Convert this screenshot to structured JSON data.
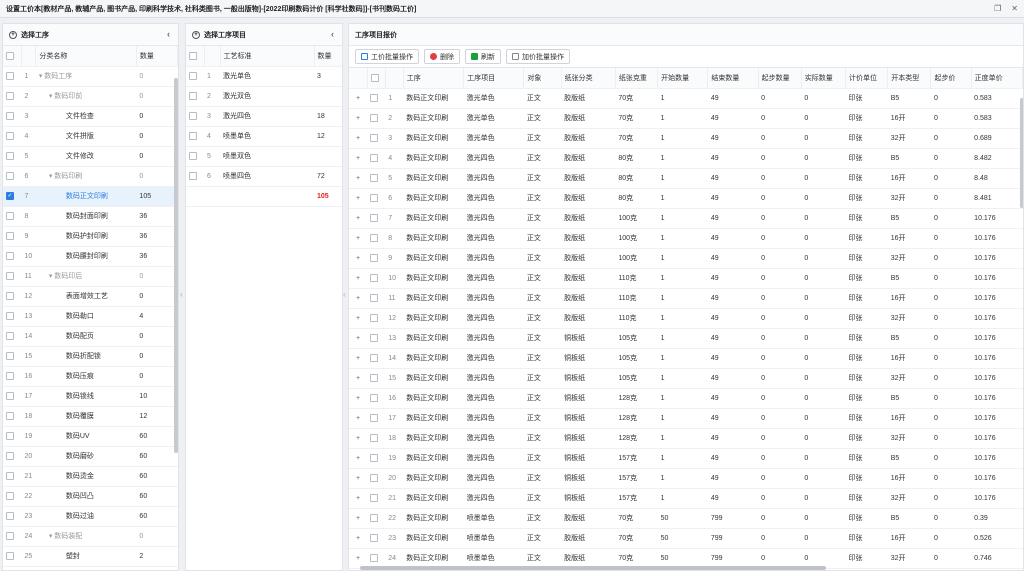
{
  "window": {
    "title": "设置工价本[教材产品, 教辅产品, 图书产品, 印刷科学技术, 社科类图书, 一般出版物]-[2022印刷数码计价 [科学社数码]]-[书刊数码工价]"
  },
  "left": {
    "header": "选择工序",
    "columns": [
      "分类名称",
      "数量"
    ],
    "rows": [
      {
        "n": "1",
        "name": "数码工序",
        "qty": "0",
        "group": true,
        "indent": 0
      },
      {
        "n": "2",
        "name": "数码印前",
        "qty": "0",
        "group": true,
        "indent": 1
      },
      {
        "n": "3",
        "name": "文件检查",
        "qty": "0",
        "group": false,
        "indent": 2
      },
      {
        "n": "4",
        "name": "文件拼版",
        "qty": "0",
        "group": false,
        "indent": 2
      },
      {
        "n": "5",
        "name": "文件修改",
        "qty": "0",
        "group": false,
        "indent": 2
      },
      {
        "n": "6",
        "name": "数码印刷",
        "qty": "0",
        "group": true,
        "indent": 1
      },
      {
        "n": "7",
        "name": "数码正文印刷",
        "qty": "105",
        "group": false,
        "indent": 2,
        "selected": true
      },
      {
        "n": "8",
        "name": "数码封面印刷",
        "qty": "36",
        "group": false,
        "indent": 2
      },
      {
        "n": "9",
        "name": "数码护封印刷",
        "qty": "36",
        "group": false,
        "indent": 2
      },
      {
        "n": "10",
        "name": "数码腰封印刷",
        "qty": "36",
        "group": false,
        "indent": 2
      },
      {
        "n": "11",
        "name": "数码印后",
        "qty": "0",
        "group": true,
        "indent": 1
      },
      {
        "n": "12",
        "name": "表面增效工艺",
        "qty": "0",
        "group": false,
        "indent": 2
      },
      {
        "n": "13",
        "name": "数码勒口",
        "qty": "4",
        "group": false,
        "indent": 2
      },
      {
        "n": "14",
        "name": "数码配页",
        "qty": "0",
        "group": false,
        "indent": 2
      },
      {
        "n": "15",
        "name": "数码折配锁",
        "qty": "0",
        "group": false,
        "indent": 2
      },
      {
        "n": "16",
        "name": "数码压痕",
        "qty": "0",
        "group": false,
        "indent": 2
      },
      {
        "n": "17",
        "name": "数码锁线",
        "qty": "10",
        "group": false,
        "indent": 2
      },
      {
        "n": "18",
        "name": "数码覆膜",
        "qty": "12",
        "group": false,
        "indent": 2
      },
      {
        "n": "19",
        "name": "数码UV",
        "qty": "60",
        "group": false,
        "indent": 2
      },
      {
        "n": "20",
        "name": "数码磨砂",
        "qty": "60",
        "group": false,
        "indent": 2
      },
      {
        "n": "21",
        "name": "数码烫金",
        "qty": "60",
        "group": false,
        "indent": 2
      },
      {
        "n": "22",
        "name": "数码凹凸",
        "qty": "60",
        "group": false,
        "indent": 2
      },
      {
        "n": "23",
        "name": "数码过油",
        "qty": "60",
        "group": false,
        "indent": 2
      },
      {
        "n": "24",
        "name": "数码装配",
        "qty": "0",
        "group": true,
        "indent": 1
      },
      {
        "n": "25",
        "name": "塑封",
        "qty": "2",
        "group": false,
        "indent": 2
      }
    ]
  },
  "middle": {
    "header": "选择工序项目",
    "columns": [
      "工艺标准",
      "数量"
    ],
    "rows": [
      {
        "n": "1",
        "name": "激光单色",
        "qty": "3"
      },
      {
        "n": "2",
        "name": "激光双色",
        "qty": ""
      },
      {
        "n": "3",
        "name": "激光四色",
        "qty": "18"
      },
      {
        "n": "4",
        "name": "喷墨单色",
        "qty": "12"
      },
      {
        "n": "5",
        "name": "喷墨双色",
        "qty": ""
      },
      {
        "n": "6",
        "name": "喷墨四色",
        "qty": "72"
      }
    ],
    "total": "105"
  },
  "right": {
    "header": "工序项目报价",
    "toolbar": {
      "batch": "工价批量操作",
      "delete": "删除",
      "refresh": "刷新",
      "addprice": "加价批量操作"
    },
    "columns": [
      "工序",
      "工序项目",
      "对象",
      "纸张分类",
      "纸张克重",
      "开始数量",
      "结束数量",
      "起步数量",
      "实际数量",
      "计价单位",
      "开本类型",
      "起步价",
      "正度单价"
    ],
    "rows": [
      [
        "数码正文印刷",
        "激光单色",
        "正文",
        "胶版纸",
        "70克",
        "1",
        "49",
        "0",
        "0",
        "印张",
        "B5",
        "0",
        "0.583"
      ],
      [
        "数码正文印刷",
        "激光单色",
        "正文",
        "胶版纸",
        "70克",
        "1",
        "49",
        "0",
        "0",
        "印张",
        "16开",
        "0",
        "0.583"
      ],
      [
        "数码正文印刷",
        "激光单色",
        "正文",
        "胶版纸",
        "70克",
        "1",
        "49",
        "0",
        "0",
        "印张",
        "32开",
        "0",
        "0.689"
      ],
      [
        "数码正文印刷",
        "激光四色",
        "正文",
        "胶版纸",
        "80克",
        "1",
        "49",
        "0",
        "0",
        "印张",
        "B5",
        "0",
        "8.482"
      ],
      [
        "数码正文印刷",
        "激光四色",
        "正文",
        "胶版纸",
        "80克",
        "1",
        "49",
        "0",
        "0",
        "印张",
        "16开",
        "0",
        "8.48"
      ],
      [
        "数码正文印刷",
        "激光四色",
        "正文",
        "胶版纸",
        "80克",
        "1",
        "49",
        "0",
        "0",
        "印张",
        "32开",
        "0",
        "8.481"
      ],
      [
        "数码正文印刷",
        "激光四色",
        "正文",
        "胶版纸",
        "100克",
        "1",
        "49",
        "0",
        "0",
        "印张",
        "B5",
        "0",
        "10.176"
      ],
      [
        "数码正文印刷",
        "激光四色",
        "正文",
        "胶版纸",
        "100克",
        "1",
        "49",
        "0",
        "0",
        "印张",
        "16开",
        "0",
        "10.176"
      ],
      [
        "数码正文印刷",
        "激光四色",
        "正文",
        "胶版纸",
        "100克",
        "1",
        "49",
        "0",
        "0",
        "印张",
        "32开",
        "0",
        "10.176"
      ],
      [
        "数码正文印刷",
        "激光四色",
        "正文",
        "胶版纸",
        "110克",
        "1",
        "49",
        "0",
        "0",
        "印张",
        "B5",
        "0",
        "10.176"
      ],
      [
        "数码正文印刷",
        "激光四色",
        "正文",
        "胶版纸",
        "110克",
        "1",
        "49",
        "0",
        "0",
        "印张",
        "16开",
        "0",
        "10.176"
      ],
      [
        "数码正文印刷",
        "激光四色",
        "正文",
        "胶版纸",
        "110克",
        "1",
        "49",
        "0",
        "0",
        "印张",
        "32开",
        "0",
        "10.176"
      ],
      [
        "数码正文印刷",
        "激光四色",
        "正文",
        "铜板纸",
        "105克",
        "1",
        "49",
        "0",
        "0",
        "印张",
        "B5",
        "0",
        "10.176"
      ],
      [
        "数码正文印刷",
        "激光四色",
        "正文",
        "铜板纸",
        "105克",
        "1",
        "49",
        "0",
        "0",
        "印张",
        "16开",
        "0",
        "10.176"
      ],
      [
        "数码正文印刷",
        "激光四色",
        "正文",
        "铜板纸",
        "105克",
        "1",
        "49",
        "0",
        "0",
        "印张",
        "32开",
        "0",
        "10.176"
      ],
      [
        "数码正文印刷",
        "激光四色",
        "正文",
        "铜板纸",
        "128克",
        "1",
        "49",
        "0",
        "0",
        "印张",
        "B5",
        "0",
        "10.176"
      ],
      [
        "数码正文印刷",
        "激光四色",
        "正文",
        "铜板纸",
        "128克",
        "1",
        "49",
        "0",
        "0",
        "印张",
        "16开",
        "0",
        "10.176"
      ],
      [
        "数码正文印刷",
        "激光四色",
        "正文",
        "铜板纸",
        "128克",
        "1",
        "49",
        "0",
        "0",
        "印张",
        "32开",
        "0",
        "10.176"
      ],
      [
        "数码正文印刷",
        "激光四色",
        "正文",
        "铜板纸",
        "157克",
        "1",
        "49",
        "0",
        "0",
        "印张",
        "B5",
        "0",
        "10.176"
      ],
      [
        "数码正文印刷",
        "激光四色",
        "正文",
        "铜板纸",
        "157克",
        "1",
        "49",
        "0",
        "0",
        "印张",
        "16开",
        "0",
        "10.176"
      ],
      [
        "数码正文印刷",
        "激光四色",
        "正文",
        "铜板纸",
        "157克",
        "1",
        "49",
        "0",
        "0",
        "印张",
        "32开",
        "0",
        "10.176"
      ],
      [
        "数码正文印刷",
        "喷墨单色",
        "正文",
        "胶版纸",
        "70克",
        "50",
        "799",
        "0",
        "0",
        "印张",
        "B5",
        "0",
        "0.39"
      ],
      [
        "数码正文印刷",
        "喷墨单色",
        "正文",
        "胶版纸",
        "70克",
        "50",
        "799",
        "0",
        "0",
        "印张",
        "16开",
        "0",
        "0.526"
      ],
      [
        "数码正文印刷",
        "喷墨单色",
        "正文",
        "胶版纸",
        "70克",
        "50",
        "799",
        "0",
        "0",
        "印张",
        "32开",
        "0",
        "0.746"
      ]
    ]
  }
}
